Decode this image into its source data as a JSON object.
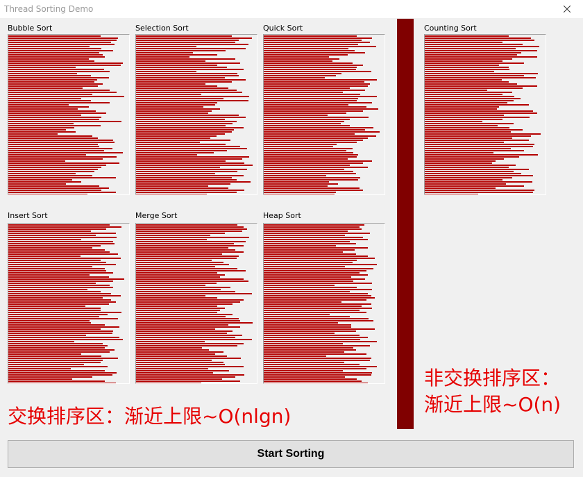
{
  "window": {
    "title": "Thread Sorting Demo"
  },
  "colors": {
    "bar": "#b40000",
    "divider": "#800000",
    "note": "#e60000"
  },
  "panels": [
    {
      "label": "Bubble Sort",
      "values": [
        78,
        93,
        92,
        87,
        90,
        69,
        79,
        89,
        77,
        80,
        82,
        68,
        73,
        97,
        95,
        57,
        81,
        86,
        58,
        70,
        85,
        75,
        73,
        80,
        76,
        63,
        86,
        92,
        71,
        98,
        62,
        70,
        86,
        51,
        68,
        59,
        74,
        83,
        62,
        79,
        77,
        96,
        55,
        78,
        56,
        49,
        57,
        42,
        71,
        76,
        89,
        90,
        76,
        77,
        88,
        81,
        97,
        66,
        92,
        80,
        48,
        94,
        83,
        79,
        76,
        73,
        57,
        71,
        91,
        54,
        62,
        49,
        77,
        85,
        79,
        91,
        67,
        49
      ]
    },
    {
      "label": "Selection Sort",
      "values": [
        81,
        98,
        87,
        84,
        95,
        51,
        93,
        76,
        48,
        69,
        45,
        84,
        59,
        88,
        69,
        77,
        91,
        51,
        86,
        87,
        75,
        93,
        81,
        59,
        69,
        78,
        85,
        90,
        55,
        96,
        74,
        95,
        69,
        67,
        57,
        71,
        64,
        61,
        87,
        93,
        75,
        85,
        82,
        76,
        91,
        83,
        81,
        75,
        68,
        63,
        80,
        54,
        76,
        88,
        94,
        77,
        66,
        52,
        96,
        90,
        76,
        92,
        99,
        71,
        94,
        86,
        67,
        91,
        81,
        85,
        97,
        80,
        61,
        78,
        92,
        85,
        60,
        78
      ]
    },
    {
      "label": "Quick Sort",
      "values": [
        79,
        92,
        83,
        90,
        80,
        95,
        72,
        77,
        86,
        71,
        55,
        64,
        58,
        75,
        84,
        79,
        78,
        91,
        66,
        61,
        52,
        96,
        85,
        90,
        88,
        73,
        86,
        67,
        82,
        96,
        80,
        79,
        92,
        72,
        87,
        97,
        84,
        70,
        54,
        89,
        73,
        68,
        65,
        73,
        93,
        86,
        98,
        77,
        95,
        88,
        84,
        79,
        62,
        59,
        75,
        70,
        76,
        80,
        79,
        71,
        92,
        84,
        73,
        88,
        68,
        76,
        78,
        53,
        82,
        80,
        55,
        63,
        54,
        81,
        84,
        61,
        60,
        49
      ]
    },
    {
      "label": "Counting Sort",
      "values": [
        71,
        90,
        93,
        66,
        83,
        97,
        77,
        95,
        82,
        78,
        95,
        74,
        66,
        84,
        63,
        71,
        72,
        59,
        96,
        84,
        94,
        65,
        71,
        78,
        95,
        83,
        53,
        74,
        66,
        76,
        81,
        75,
        70,
        88,
        63,
        61,
        92,
        95,
        67,
        89,
        66,
        49,
        75,
        62,
        72,
        83,
        73,
        98,
        90,
        74,
        88,
        67,
        93,
        92,
        73,
        84,
        58,
        96,
        80,
        67,
        60,
        57,
        77,
        71,
        88,
        75,
        82,
        92,
        74,
        66,
        91,
        69,
        84,
        60,
        93,
        92,
        45,
        41
      ]
    },
    {
      "label": "Insert Sort",
      "values": [
        86,
        96,
        83,
        70,
        91,
        74,
        92,
        62,
        89,
        90,
        78,
        71,
        82,
        86,
        93,
        61,
        95,
        78,
        83,
        91,
        71,
        82,
        83,
        89,
        69,
        85,
        98,
        89,
        74,
        86,
        89,
        67,
        78,
        87,
        95,
        80,
        87,
        91,
        85,
        65,
        78,
        78,
        96,
        84,
        77,
        93,
        69,
        70,
        82,
        94,
        78,
        89,
        88,
        66,
        94,
        97,
        56,
        80,
        84,
        82,
        90,
        86,
        62,
        79,
        93,
        80,
        78,
        64,
        84,
        53,
        82,
        92,
        88,
        71,
        54,
        82,
        91,
        84
      ]
    },
    {
      "label": "Merge Sort",
      "values": [
        86,
        91,
        94,
        90,
        75,
        63,
        96,
        60,
        93,
        83,
        91,
        78,
        84,
        91,
        73,
        87,
        85,
        64,
        74,
        79,
        67,
        86,
        93,
        69,
        75,
        71,
        91,
        95,
        68,
        59,
        80,
        72,
        84,
        98,
        59,
        69,
        91,
        88,
        82,
        69,
        75,
        71,
        69,
        82,
        76,
        87,
        88,
        99,
        78,
        88,
        67,
        82,
        77,
        90,
        84,
        98,
        58,
        91,
        86,
        56,
        62,
        74,
        67,
        77,
        89,
        64,
        74,
        75,
        91,
        61,
        79,
        65,
        92,
        84,
        73,
        88,
        55,
        77
      ]
    },
    {
      "label": "Heap Sort",
      "values": [
        85,
        81,
        83,
        71,
        90,
        69,
        84,
        88,
        73,
        78,
        61,
        88,
        77,
        67,
        78,
        88,
        94,
        79,
        75,
        96,
        69,
        93,
        87,
        81,
        88,
        74,
        86,
        76,
        92,
        60,
        79,
        92,
        73,
        88,
        91,
        94,
        87,
        66,
        91,
        83,
        92,
        81,
        87,
        56,
        73,
        89,
        93,
        63,
        74,
        74,
        94,
        78,
        60,
        81,
        88,
        82,
        96,
        67,
        90,
        76,
        78,
        68,
        87,
        53,
        91,
        90,
        68,
        81,
        96,
        87,
        67,
        92,
        91,
        69,
        79,
        83,
        88,
        58
      ]
    }
  ],
  "notes": {
    "exchange": "交换排序区：渐近上限~O(nlgn)",
    "nonexchange_line1": "非交换排序区：",
    "nonexchange_line2": "渐近上限~O(n)"
  },
  "button": {
    "label": "Start Sorting"
  }
}
